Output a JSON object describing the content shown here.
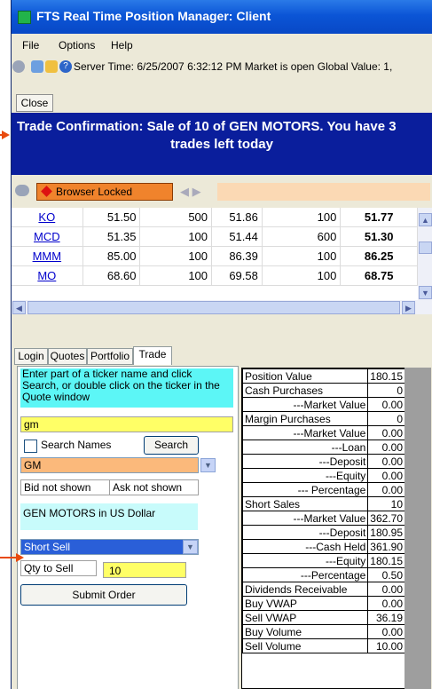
{
  "window": {
    "title": "FTS Real Time Position Manager: Client"
  },
  "menu": {
    "items": [
      "File",
      "Options",
      "Help"
    ]
  },
  "toolbar": {
    "status_text": "Server Time: 6/25/2007 6:32:12 PM  Market is open  Global Value: 1,"
  },
  "close_label": "Close",
  "confirmation": {
    "line1": "Trade Confirmation: Sale of 10 of GEN MOTORS. You have 3",
    "line2": "trades left today"
  },
  "browser": {
    "lock_label": "Browser Locked",
    "address_value": ""
  },
  "quote_rows": [
    {
      "ticker": "KO",
      "bid": "51.50",
      "bid_size": "500",
      "ask": "51.86",
      "ask_size": "100",
      "last": "51.77"
    },
    {
      "ticker": "MCD",
      "bid": "51.35",
      "bid_size": "100",
      "ask": "51.44",
      "ask_size": "600",
      "last": "51.30"
    },
    {
      "ticker": "MMM",
      "bid": "85.00",
      "bid_size": "100",
      "ask": "86.39",
      "ask_size": "100",
      "last": "86.25"
    },
    {
      "ticker": "MO",
      "bid": "68.60",
      "bid_size": "100",
      "ask": "69.58",
      "ask_size": "100",
      "last": "68.75"
    }
  ],
  "tabs": [
    "Login",
    "Quotes",
    "Portfolio",
    "Trade"
  ],
  "active_tab": "Trade",
  "trade": {
    "hint": "Enter part of a ticker name and click Search, or double click on the ticker in the Quote window",
    "ticker_input": "gm",
    "search_names_label": "Search Names",
    "search_button": "Search",
    "symbol_selected": "GM",
    "bid_text": "Bid not shown",
    "ask_text": "Ask not shown",
    "company_text": "GEN MOTORS in US Dollar",
    "order_type": "Short Sell",
    "qty_label": "Qty to Sell",
    "qty_value": "10",
    "submit_button": "Submit Order"
  },
  "position": [
    {
      "label": "Position Value",
      "value": "180.15"
    },
    {
      "label": "Cash Purchases",
      "value": "0"
    },
    {
      "label": "---Market Value",
      "value": "0.00",
      "indent": true
    },
    {
      "label": "Margin Purchases",
      "value": "0"
    },
    {
      "label": "---Market Value",
      "value": "0.00",
      "indent": true
    },
    {
      "label": "---Loan",
      "value": "0.00",
      "indent": true
    },
    {
      "label": "---Deposit",
      "value": "0.00",
      "indent": true
    },
    {
      "label": "---Equity",
      "value": "0.00",
      "indent": true
    },
    {
      "label": "--- Percentage",
      "value": "0.00",
      "indent": true
    },
    {
      "label": "Short Sales",
      "value": "10"
    },
    {
      "label": "---Market Value",
      "value": "362.70",
      "indent": true
    },
    {
      "label": "---Deposit",
      "value": "180.95",
      "indent": true
    },
    {
      "label": "---Cash Held",
      "value": "361.90",
      "indent": true
    },
    {
      "label": "---Equity",
      "value": "180.15",
      "indent": true
    },
    {
      "label": "---Percentage",
      "value": "0.50",
      "indent": true
    },
    {
      "label": "Dividends Receivable",
      "value": "0.00"
    },
    {
      "label": "Buy VWAP",
      "value": "0.00"
    },
    {
      "label": "Sell VWAP",
      "value": "36.19"
    },
    {
      "label": "Buy Volume",
      "value": "0.00"
    },
    {
      "label": "Sell Volume",
      "value": "10.00"
    }
  ],
  "colors": {
    "title_bar": "#0b55d6",
    "confirmation_bg": "#0a1e9c",
    "highlight_yellow": "#ffff66",
    "highlight_cyan": "#5cf6f6",
    "lock_orange": "#f0832c",
    "annotation_arrow": "#e84a0e"
  }
}
